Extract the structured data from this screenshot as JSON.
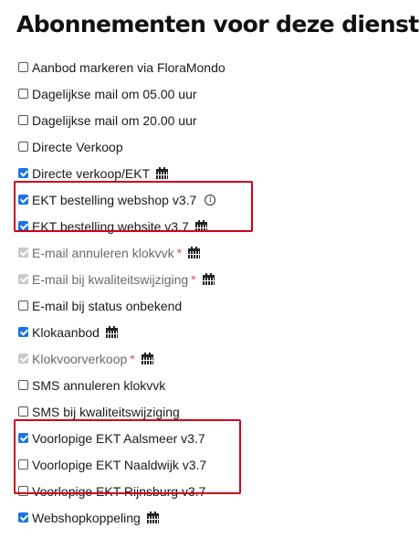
{
  "title": "Abonnementen voor deze dienst",
  "subscriptions": [
    {
      "label": "Aanbod markeren via FloraMondo",
      "checked": false
    },
    {
      "label": "Dagelijkse mail om 05.00 uur",
      "checked": false
    },
    {
      "label": "Dagelijkse mail om 20.00 uur",
      "checked": false
    },
    {
      "label": "Directe Verkoop",
      "checked": false
    },
    {
      "label": "Directe verkoop/EKT",
      "checked": true,
      "icon": "calendar-icon"
    },
    {
      "label": "EKT bestelling webshop v3.7",
      "checked": true,
      "icon": "info-icon",
      "info_glyph": "i"
    },
    {
      "label": "EKT bestelling website v3.7",
      "checked": true,
      "icon": "calendar-icon"
    },
    {
      "label": "E-mail annuleren klokvvk",
      "checked": true,
      "disabled": true,
      "required": "*",
      "icon": "calendar-icon"
    },
    {
      "label": "E-mail bij kwaliteitswijziging",
      "checked": true,
      "disabled": true,
      "required": "*",
      "icon": "calendar-icon"
    },
    {
      "label": "E-mail bij status onbekend",
      "checked": false
    },
    {
      "label": "Klokaanbod",
      "checked": true,
      "icon": "calendar-icon"
    },
    {
      "label": "Klokvoorverkoop",
      "checked": true,
      "disabled": true,
      "required": "*",
      "icon": "calendar-icon"
    },
    {
      "label": "SMS annuleren klokvvk",
      "checked": false
    },
    {
      "label": "SMS bij kwaliteitswijziging",
      "checked": false
    },
    {
      "label": "Voorlopige EKT Aalsmeer v3.7",
      "checked": true
    },
    {
      "label": "Voorlopige EKT Naaldwijk v3.7",
      "checked": false
    },
    {
      "label": "Voorlopige EKT Rijnsburg v3.7",
      "checked": false
    },
    {
      "label": "Webshopkoppeling",
      "checked": true,
      "icon": "calendar-icon"
    }
  ],
  "colors": {
    "checkbox_checked": "#1a73e8",
    "checkbox_disabled": "#c8c8c8",
    "required": "#d9534f",
    "highlight": "#d0021b"
  }
}
